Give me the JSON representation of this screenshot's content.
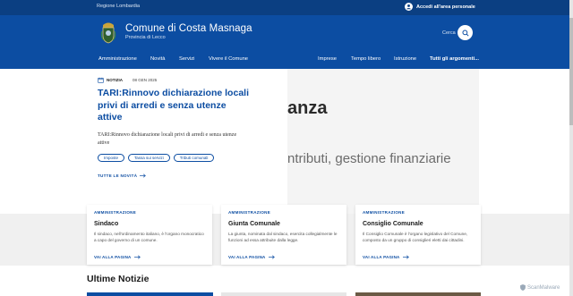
{
  "topbar": {
    "region": "Regione Lombardia",
    "login": "Accedi all'area personale"
  },
  "header": {
    "title": "Comune di Costa Masnaga",
    "subtitle": "Provincia di Lecco",
    "search_label": "Cerca"
  },
  "nav": {
    "left": [
      "Amministrazione",
      "Novità",
      "Servizi",
      "Vivere il Comune"
    ],
    "right": [
      "Imprese",
      "Tempo libero",
      "Istruzione"
    ],
    "all_topics": "Tutti gli argomenti..."
  },
  "hero": {
    "tag": "NOTIZIA",
    "date": "08 GEN 2025",
    "title": "TARI:Rinnovo dichiarazione locali privi di arredi e senza utenze attive",
    "description": "TARI:Rinnovo dichiarazione locali privi di arredi e senza utenze attive",
    "chips": [
      "Imposte",
      "Tassa sui servizi",
      "Tributi comunali"
    ],
    "all_news": "TUTTE LE NOVITÀ",
    "image_text_1": "anza",
    "image_text_2": "ntributi, gestione finanziarie"
  },
  "cards": [
    {
      "category": "AMMINISTRAZIONE",
      "title": "Sindaco",
      "text": "Il sindaco, nell'ordinamento italiano, è l'organo monocratico a capo del governo di un comune.",
      "link": "VAI ALLA PAGINA"
    },
    {
      "category": "AMMINISTRAZIONE",
      "title": "Giunta Comunale",
      "text": "La giunta, nominata dal sindaco, esercita collegialmente le funzioni ad essa attribuite dalla legge.",
      "link": "VAI ALLA PAGINA"
    },
    {
      "category": "AMMINISTRAZIONE",
      "title": "Consiglio Comunale",
      "text": "Il Consiglio Comunale è l'organo legislativo del Comune, composto da un gruppo di consiglieri eletti dai cittadini.",
      "link": "VAI ALLA PAGINA"
    }
  ],
  "latest": {
    "title": "Ultime Notizie"
  },
  "watermark": "ScanMalware",
  "colors": {
    "brand": "#0c4da2",
    "brand_dark": "#0b3f82",
    "band": "#f0f0f0"
  }
}
